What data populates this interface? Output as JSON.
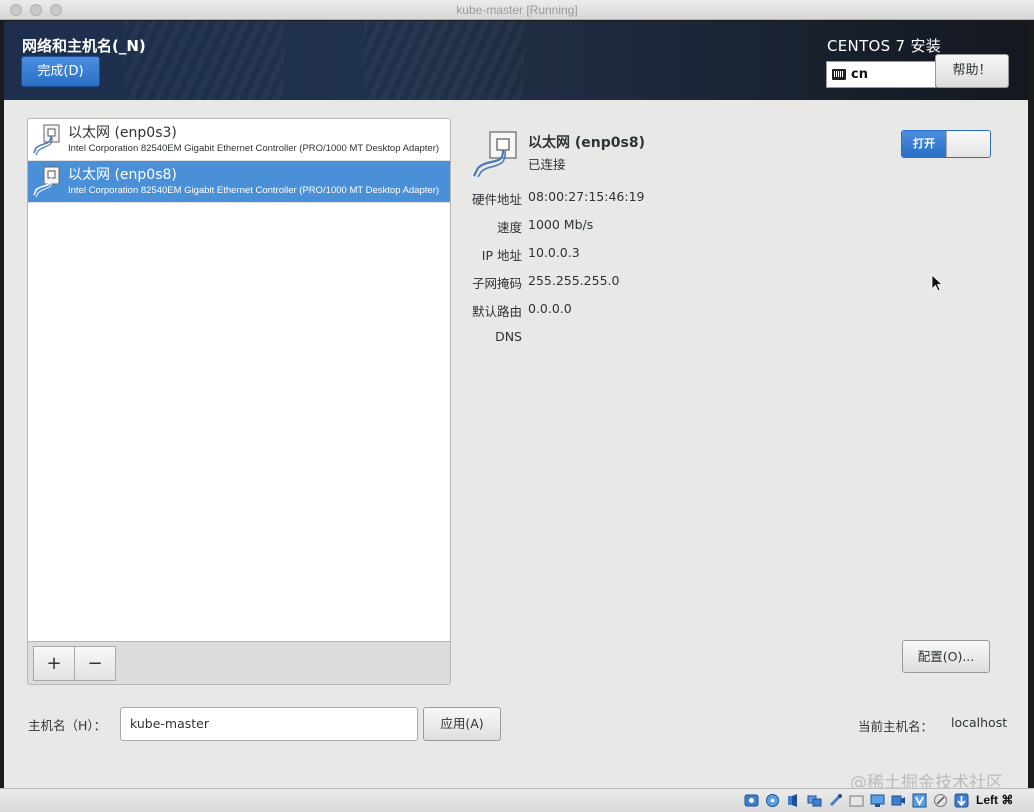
{
  "window": {
    "title": "kube-master [Running]"
  },
  "header": {
    "title": "网络和主机名(_N)",
    "done_label": "完成(D)",
    "product": "CENTOS 7 安装",
    "keyboard_layout": "cn",
    "help_label": "帮助！"
  },
  "devices": [
    {
      "name": "以太网 (enp0s3)",
      "description": "Intel Corporation 82540EM Gigabit Ethernet Controller (PRO/1000 MT Desktop Adapter)",
      "selected": false
    },
    {
      "name": "以太网 (enp0s8)",
      "description": "Intel Corporation 82540EM Gigabit Ethernet Controller (PRO/1000 MT Desktop Adapter)",
      "selected": true
    }
  ],
  "list_toolbar": {
    "add": "+",
    "remove": "−"
  },
  "detail": {
    "name": "以太网 (enp0s8)",
    "status": "已连接",
    "switch_label": "打开",
    "switch_on": true,
    "props": [
      {
        "label": "硬件地址",
        "value": "08:00:27:15:46:19"
      },
      {
        "label": "速度",
        "value": "1000 Mb/s"
      },
      {
        "label": "IP 地址",
        "value": "10.0.0.3"
      },
      {
        "label": "子网掩码",
        "value": "255.255.255.0"
      },
      {
        "label": "默认路由",
        "value": "0.0.0.0"
      },
      {
        "label": "DNS",
        "value": ""
      }
    ],
    "config_label": "配置(O)..."
  },
  "hostname": {
    "label": "主机名（H）：",
    "value": "kube-master",
    "apply_label": "应用(A)",
    "current_label": "当前主机名：",
    "current_value": "localhost"
  },
  "watermark": "@稀土掘金技术社区",
  "statusbar": {
    "host_key": "Left ⌘"
  },
  "colors": {
    "accent": "#4a90d9",
    "header_bg": "#1d2f4d",
    "panel_bg": "#e8e8e7"
  }
}
